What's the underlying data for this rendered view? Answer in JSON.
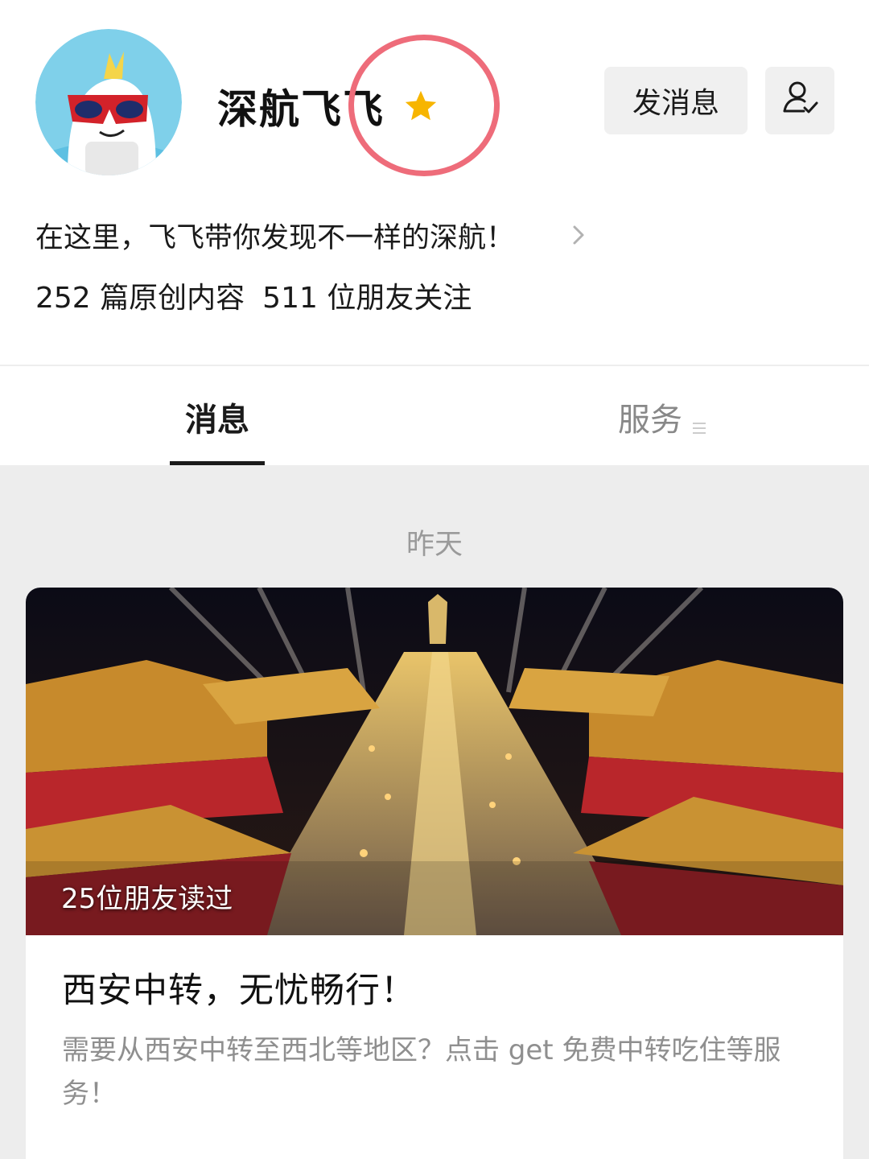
{
  "profile": {
    "name": "深航飞飞",
    "bio": "在这里，飞飞带你发现不一样的深航！",
    "articles": "252 篇原创内容",
    "followers": "511 位朋友关注",
    "send_message_label": "发消息"
  },
  "tabs": {
    "messages": "消息",
    "services": "服务"
  },
  "feed": {
    "date": "昨天",
    "article": {
      "read_count": "25位朋友读过",
      "title": "西安中转，无忧畅行！",
      "summary": "需要从西安中转至西北等地区？点击 get 免费中转吃住等服务！"
    }
  },
  "icons": [
    "avatar",
    "star-icon",
    "follow-icon",
    "chevron-right-icon",
    "menu-icon"
  ],
  "colors": {
    "highlight": "#ee6c7a",
    "star": "#f7b500",
    "active_tab": "#1a1a1a",
    "inactive_tab": "#888888"
  }
}
